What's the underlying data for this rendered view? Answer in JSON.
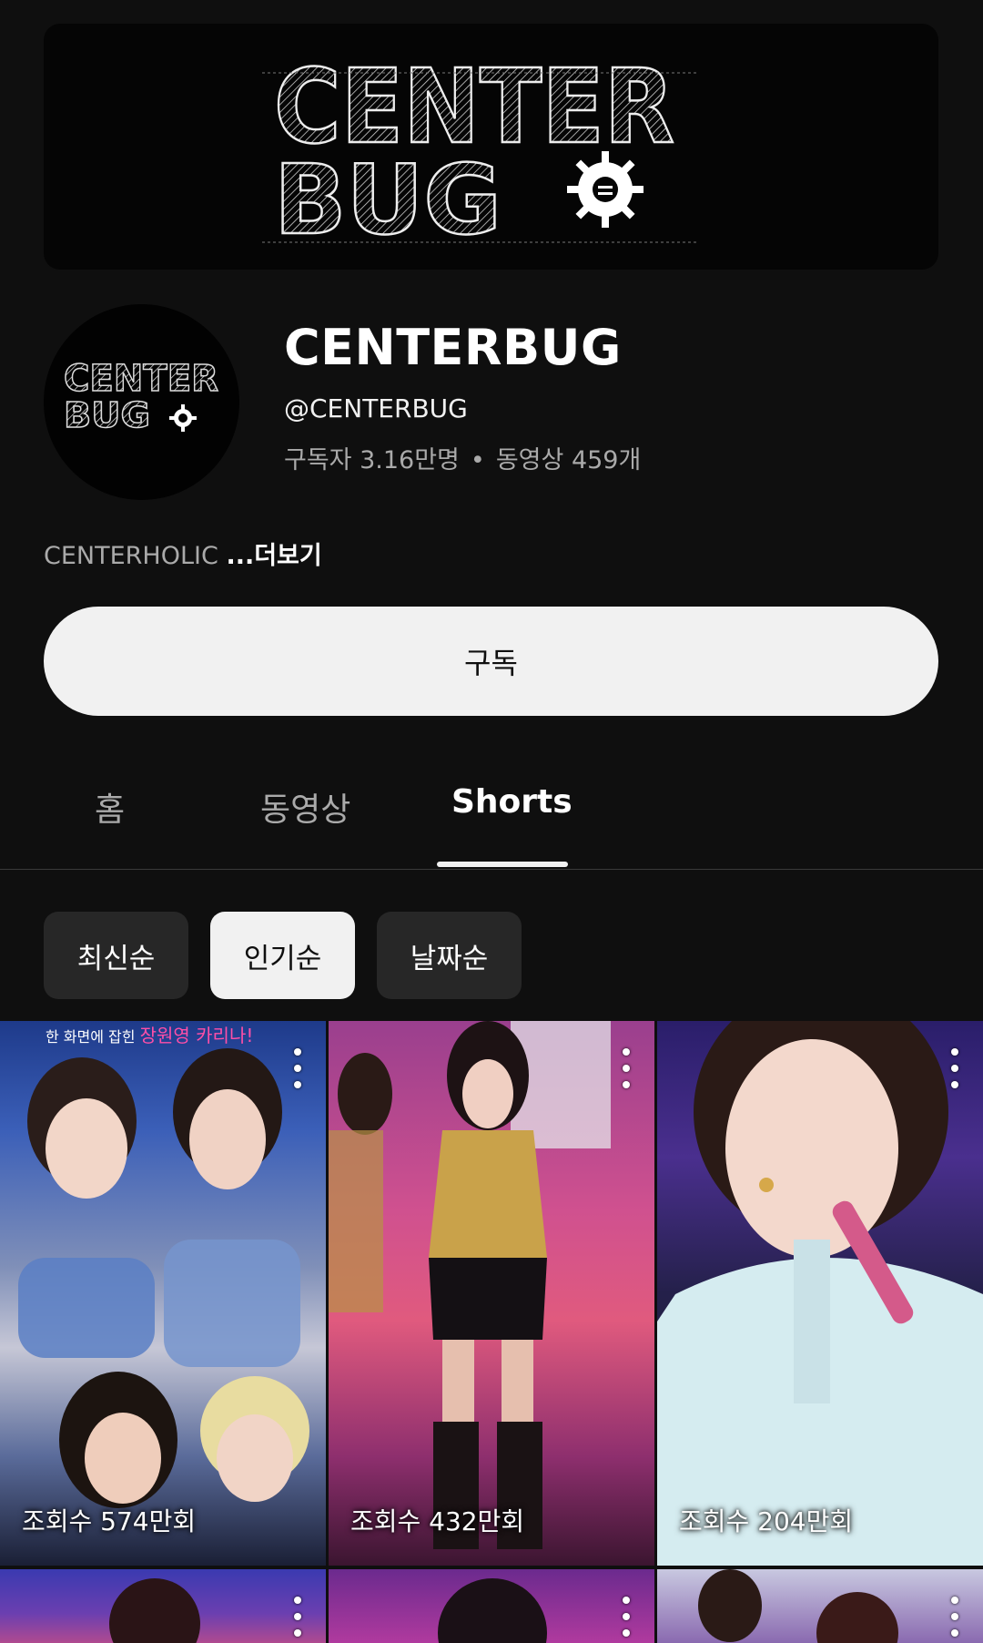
{
  "banner": {
    "logo_line1": "CENTER",
    "logo_line2": "BUG"
  },
  "avatar": {
    "logo_line1": "CENTER",
    "logo_line2": "BUG"
  },
  "channel": {
    "name": "CENTERBUG",
    "handle": "@CENTERBUG",
    "subscribers": "구독자 3.16만명",
    "separator": "•",
    "videos": "동영상 459개",
    "description": "CENTERHOLIC",
    "more_label": "...더보기"
  },
  "subscribe_label": "구독",
  "tabs": [
    {
      "label": "홈",
      "active": false
    },
    {
      "label": "동영상",
      "active": false
    },
    {
      "label": "Shorts",
      "active": true
    }
  ],
  "sort_chips": [
    {
      "label": "최신순",
      "selected": false
    },
    {
      "label": "인기순",
      "selected": true
    },
    {
      "label": "날짜순",
      "selected": false
    }
  ],
  "shorts": [
    {
      "views": "조회수 574만회",
      "caption_prefix": "한 화면에 잡힌",
      "caption_highlight": "장원영 카리나!"
    },
    {
      "views": "조회수 432만회"
    },
    {
      "views": "조회수 204만회"
    }
  ],
  "colors": {
    "background": "#0f0f0f",
    "chip": "#272727",
    "accent_light": "#f1f1f1"
  }
}
